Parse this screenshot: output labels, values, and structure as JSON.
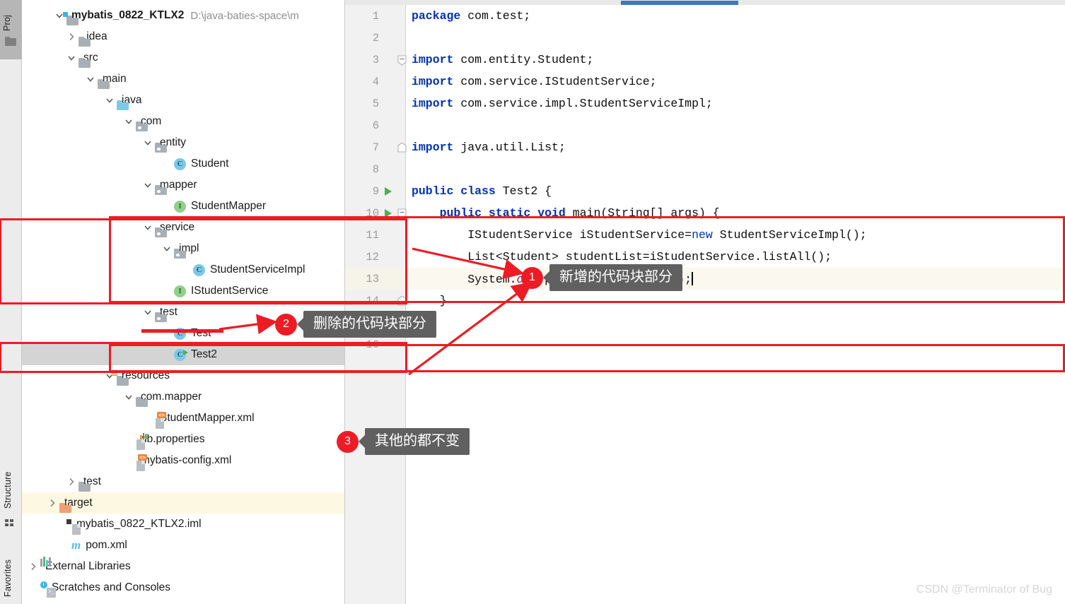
{
  "toolstrip": {
    "tabs": [
      {
        "name": "project",
        "label": "Proj",
        "icon": "folder-icon"
      },
      {
        "name": "structure",
        "label": "Structure",
        "icon": "structure-icon"
      },
      {
        "name": "favorites",
        "label": "Favorites",
        "icon": ""
      }
    ]
  },
  "project_tree": {
    "root": {
      "label": "mybatis_0822_KTLX2",
      "path": "D:\\java-baties-space\\m"
    },
    "items": [
      {
        "label": ".idea",
        "icon": "folder-gray-icon",
        "chevron": "right",
        "indent": 1
      },
      {
        "label": "src",
        "icon": "folder-gray-icon",
        "chevron": "down",
        "indent": 1
      },
      {
        "label": "main",
        "icon": "folder-gray-icon",
        "chevron": "down",
        "indent": 2
      },
      {
        "label": "java",
        "icon": "folder-source-icon",
        "chevron": "down",
        "indent": 3
      },
      {
        "label": "com",
        "icon": "folder-package-icon",
        "chevron": "down",
        "indent": 4
      },
      {
        "label": "entity",
        "icon": "folder-package-icon",
        "chevron": "down",
        "indent": 5
      },
      {
        "label": "Student",
        "icon": "java-class-icon",
        "chevron": "none",
        "indent": 6
      },
      {
        "label": "mapper",
        "icon": "folder-package-icon",
        "chevron": "down",
        "indent": 5
      },
      {
        "label": "StudentMapper",
        "icon": "java-interface-icon",
        "chevron": "none",
        "indent": 6
      },
      {
        "label": "service",
        "icon": "folder-package-icon",
        "chevron": "down",
        "indent": 5
      },
      {
        "label": "impl",
        "icon": "folder-package-icon",
        "chevron": "down",
        "indent": 6
      },
      {
        "label": "StudentServiceImpl",
        "icon": "java-class-icon",
        "chevron": "none",
        "indent": 7
      },
      {
        "label": "IStudentService",
        "icon": "java-interface-icon",
        "chevron": "none",
        "indent": 6
      },
      {
        "label": "test",
        "icon": "folder-package-icon",
        "chevron": "down",
        "indent": 5
      },
      {
        "label": "Test",
        "icon": "java-class-runnable-icon",
        "chevron": "none",
        "indent": 6
      },
      {
        "label": "Test2",
        "icon": "java-class-runnable-icon",
        "chevron": "none",
        "indent": 6,
        "selected": true
      },
      {
        "label": "resources",
        "icon": "folder-resources-icon",
        "chevron": "down",
        "indent": 3
      },
      {
        "label": "com.mapper",
        "icon": "folder-gray-icon",
        "chevron": "down",
        "indent": 4
      },
      {
        "label": "StudentMapper.xml",
        "icon": "xml-file-icon",
        "chevron": "none",
        "indent": 5
      },
      {
        "label": "db.properties",
        "icon": "properties-file-icon",
        "chevron": "none",
        "indent": 4
      },
      {
        "label": "mybatis-config.xml",
        "icon": "xml-file-icon",
        "chevron": "none",
        "indent": 4
      },
      {
        "label": "test",
        "icon": "folder-gray-icon",
        "chevron": "right",
        "indent": 2
      },
      {
        "label": "target",
        "icon": "folder-orange-icon",
        "chevron": "right",
        "indent": 1,
        "highlighted": true
      },
      {
        "label": "mybatis_0822_KTLX2.iml",
        "icon": "iml-file-icon",
        "chevron": "none",
        "indent": 1
      },
      {
        "label": "pom.xml",
        "icon": "maven-icon",
        "chevron": "none",
        "indent": 1
      },
      {
        "label": "External Libraries",
        "icon": "external-libraries-icon",
        "chevron": "right",
        "indent": 0
      },
      {
        "label": "Scratches and Consoles",
        "icon": "scratches-icon",
        "chevron": "none",
        "indent": 0
      }
    ]
  },
  "editor": {
    "lines": [
      {
        "num": "1",
        "segments": [
          {
            "t": "package ",
            "c": "k"
          },
          {
            "t": "com.test;",
            "c": ""
          }
        ]
      },
      {
        "num": "2",
        "segments": []
      },
      {
        "num": "3",
        "segments": [
          {
            "t": "import ",
            "c": "k"
          },
          {
            "t": "com.entity.Student;",
            "c": ""
          }
        ],
        "fold": "open"
      },
      {
        "num": "4",
        "segments": [
          {
            "t": "import ",
            "c": "k"
          },
          {
            "t": "com.service.IStudentService;",
            "c": ""
          }
        ]
      },
      {
        "num": "5",
        "segments": [
          {
            "t": "import ",
            "c": "k"
          },
          {
            "t": "com.service.impl.StudentServiceImpl;",
            "c": ""
          }
        ]
      },
      {
        "num": "6",
        "segments": []
      },
      {
        "num": "7",
        "segments": [
          {
            "t": "import ",
            "c": "k"
          },
          {
            "t": "java.util.List;",
            "c": ""
          }
        ],
        "fold": "end"
      },
      {
        "num": "8",
        "segments": []
      },
      {
        "num": "9",
        "segments": [
          {
            "t": "public class ",
            "c": "k"
          },
          {
            "t": "Test2 {",
            "c": ""
          }
        ],
        "run": true
      },
      {
        "num": "10",
        "segments": [
          {
            "t": "    ",
            "c": ""
          },
          {
            "t": "public static void ",
            "c": "k"
          },
          {
            "t": "main(String[] args) {",
            "c": ""
          }
        ],
        "run": true,
        "fold": "open"
      },
      {
        "num": "11",
        "segments": [
          {
            "t": "        IStudentService iStudentService=",
            "c": ""
          },
          {
            "t": "new ",
            "c": "kw"
          },
          {
            "t": "StudentServiceImpl();",
            "c": ""
          }
        ]
      },
      {
        "num": "12",
        "segments": [
          {
            "t": "        List<Student> studentList=iStudentService.listAll();",
            "c": ""
          }
        ]
      },
      {
        "num": "13",
        "segments": [
          {
            "t": "        System.",
            "c": ""
          },
          {
            "t": "out",
            "c": "fld"
          },
          {
            "t": ".println(studentList);",
            "c": ""
          }
        ],
        "current": true,
        "caret": true
      },
      {
        "num": "14",
        "segments": [
          {
            "t": "    }",
            "c": ""
          }
        ],
        "fold": "end"
      },
      {
        "num": "15",
        "segments": []
      },
      {
        "num": "16",
        "segments": []
      }
    ],
    "scrollbar": {
      "name": "horizontal-scrollbar",
      "thumb_color": "#3c79c0"
    }
  },
  "annotations": {
    "callouts": [
      {
        "num": "1",
        "text": "新增的代码块部分"
      },
      {
        "num": "2",
        "text": "删除的代码块部分"
      },
      {
        "num": "3",
        "text": "其他的都不变"
      }
    ],
    "accent_color": "#ed1c24",
    "bubble_color": "#606060"
  },
  "watermark": {
    "text": "CSDN @Terminator of Bug"
  }
}
